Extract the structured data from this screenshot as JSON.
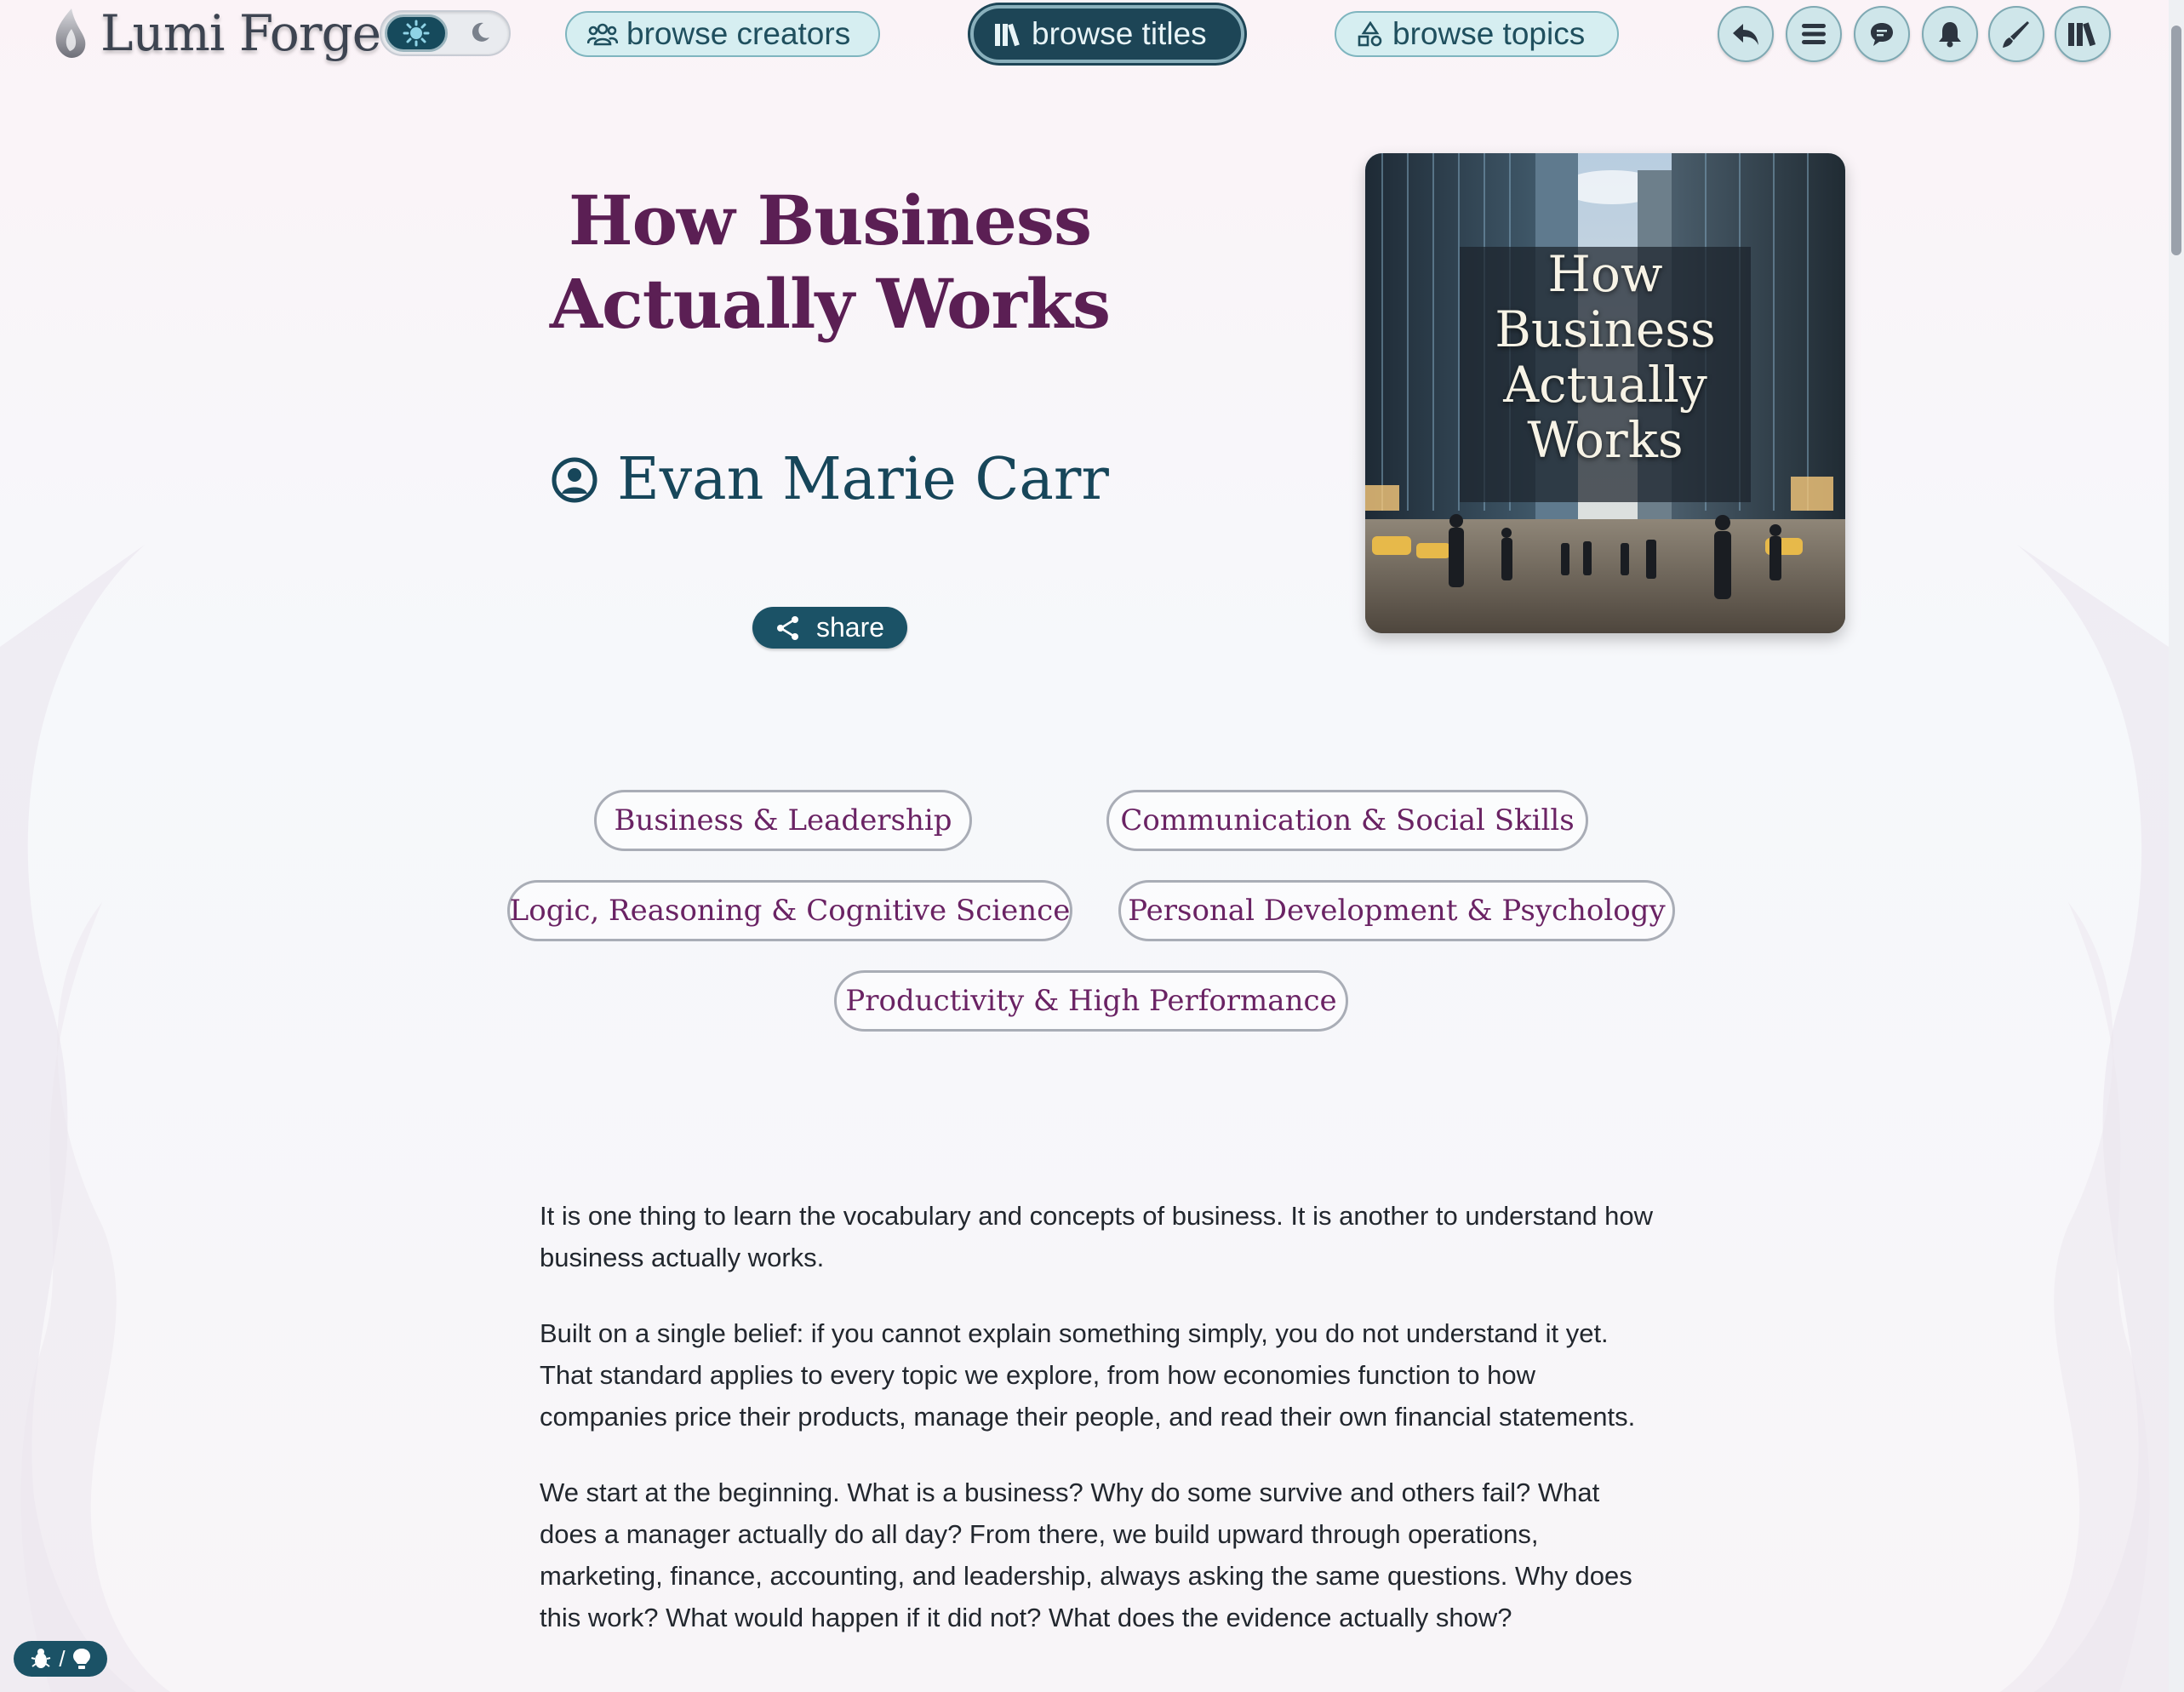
{
  "app": {
    "name": "Lumi Forge"
  },
  "nav": {
    "browse_creators": "browse creators",
    "browse_titles": "browse titles",
    "browse_topics": "browse topics"
  },
  "toolbar_icons": [
    "back-arrow-icon",
    "menu-icon",
    "chat-icon",
    "bell-icon",
    "pen-icon",
    "library-icon"
  ],
  "book": {
    "title": "How Business Actually Works",
    "author": "Evan Marie Carr",
    "share_label": "share",
    "cover_title": "How Business Actually Works"
  },
  "topics": [
    "Business & Leadership",
    "Communication & Social Skills",
    "Logic, Reasoning & Cognitive Science",
    "Personal Development & Psychology",
    "Productivity & High Performance"
  ],
  "description": [
    "It is one thing to learn the vocabulary and concepts of business. It is another to understand how business actually works.",
    "Built on a single belief: if you cannot explain something simply, you do not understand it yet. That standard applies to every topic we explore, from how economies function to how companies price their products, manage their people, and read their own financial statements.",
    "We start at the beginning. What is a business? Why do some survive and others fail? What does a manager actually do all day? From there, we build upward through operations, marketing, finance, accounting, and leadership, always asking the same questions. Why does this work? What would happen if it did not? What does the evidence actually show?"
  ],
  "debug_chip": "/",
  "colors": {
    "title": "#5b1f54",
    "author": "#17465a",
    "accent": "#1b5266",
    "tag_text": "#6a2364"
  }
}
